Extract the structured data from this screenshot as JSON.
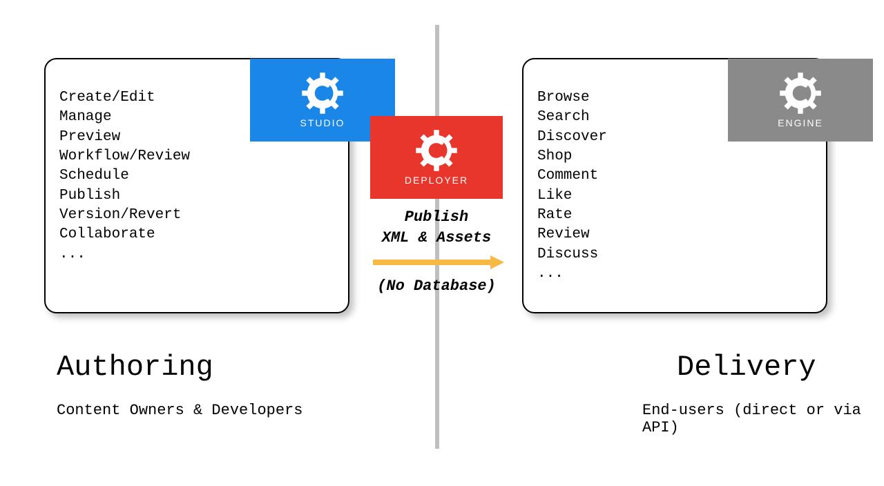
{
  "left": {
    "title": "Authoring",
    "subtitle": "Content Owners & Developers",
    "badge": "STUDIO",
    "items": "Create/Edit\nManage\nPreview\nWorkflow/Review\nSchedule\nPublish\nVersion/Revert\nCollaborate\n..."
  },
  "right": {
    "title": "Delivery",
    "subtitle": "End-users (direct or via API)",
    "badge": "ENGINE",
    "items": "Browse\nSearch\nDiscover\nShop\nComment\nLike\nRate\nReview\nDiscuss\n..."
  },
  "middle": {
    "badge": "DEPLOYER",
    "line1": "Publish\nXML & Assets",
    "line2": "(No Database)"
  },
  "colors": {
    "studio": "#1a86e8",
    "deployer": "#e8362d",
    "engine": "#8a8a8a",
    "arrow": "#f5b944",
    "divider": "#bfbfbf"
  }
}
